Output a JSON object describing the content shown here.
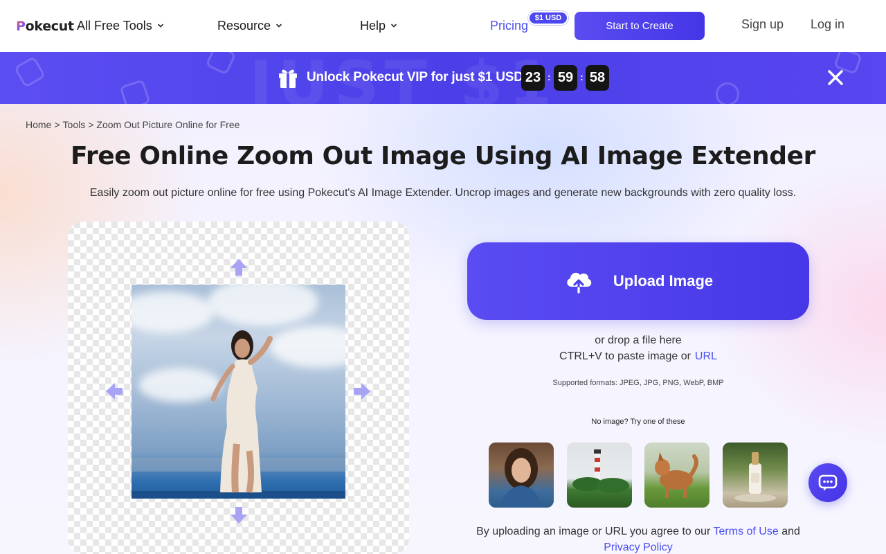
{
  "header": {
    "logo_text": "Pokecut",
    "nav": [
      {
        "label": "All Free Tools"
      },
      {
        "label": "Resource"
      },
      {
        "label": "Help"
      }
    ],
    "pricing_label": "Pricing",
    "pricing_badge": "$1 USD",
    "start_label": "Start to Create",
    "signup_label": "Sign up",
    "login_label": "Log in"
  },
  "banner": {
    "bg_text": "JUST $1",
    "text": "Unlock Pokecut VIP for just $1 USD",
    "countdown": {
      "hours": "23",
      "minutes": "59",
      "seconds": "58"
    },
    "separator": ":",
    "accent": "#4b3fe8"
  },
  "breadcrumb": {
    "items": [
      "Home",
      "Tools",
      "Zoom Out Picture Online for Free"
    ],
    "separator": ">"
  },
  "main": {
    "title": "Free Online Zoom Out Image Using AI Image Extender",
    "subtitle": "Easily zoom out picture online for free using Pokecut's AI Image Extender. Uncrop images and generate new backgrounds with zero quality loss."
  },
  "upload": {
    "button_label": "Upload Image",
    "drop_text": "or drop a file here",
    "paste_text": "CTRL+V to paste image or",
    "url_label": "URL",
    "formats": "Supported formats: JPEG, JPG, PNG, WebP, BMP",
    "try_text": "No image? Try one of these",
    "samples": [
      "woman-portrait",
      "lighthouse",
      "dog",
      "serum-bottle"
    ]
  },
  "terms": {
    "prefix": "By uploading an image or URL you agree to our",
    "terms_link": "Terms of Use",
    "and": "and",
    "privacy_link": "Privacy Policy"
  },
  "icons": {
    "chat": "chat-bubble-icon",
    "upload": "cloud-upload-icon",
    "close": "close-icon",
    "gift": "gift-icon"
  },
  "colors": {
    "brand": "#4d47ef",
    "link": "#4a4ff0"
  }
}
